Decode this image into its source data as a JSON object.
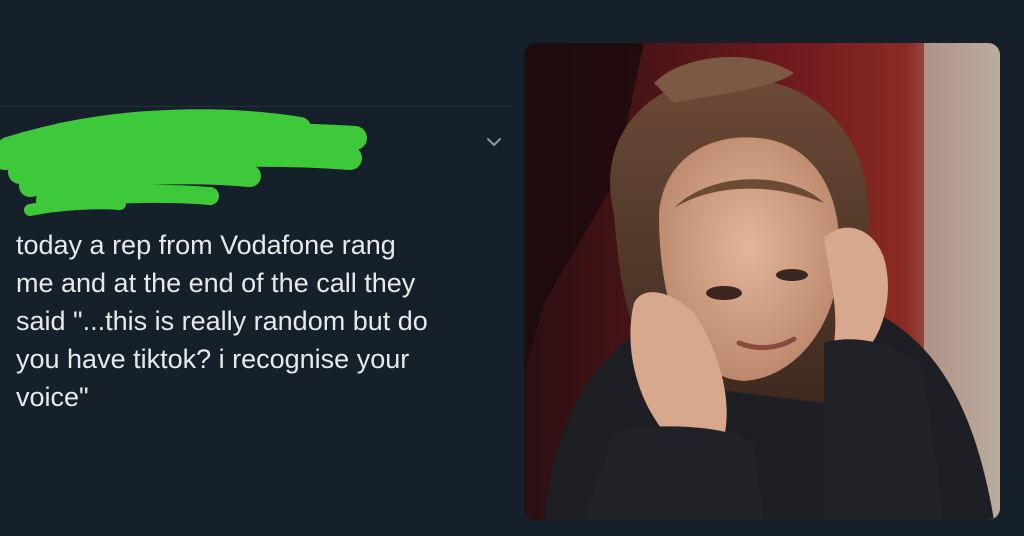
{
  "tweet": {
    "text": "today a rep from Vodafone rang\nme and at the end of the call they\nsaid \"...this is really random but do\nyou have tiktok? i recognise your\nvoice\""
  },
  "icons": {
    "menu": "chevron-down-icon",
    "avatar": "avatar",
    "redaction": "green-scribble-redaction"
  },
  "colors": {
    "background": "#15202b",
    "text": "#e7e9ea",
    "redaction": "#3ec93a",
    "icon": "#8899a6"
  }
}
